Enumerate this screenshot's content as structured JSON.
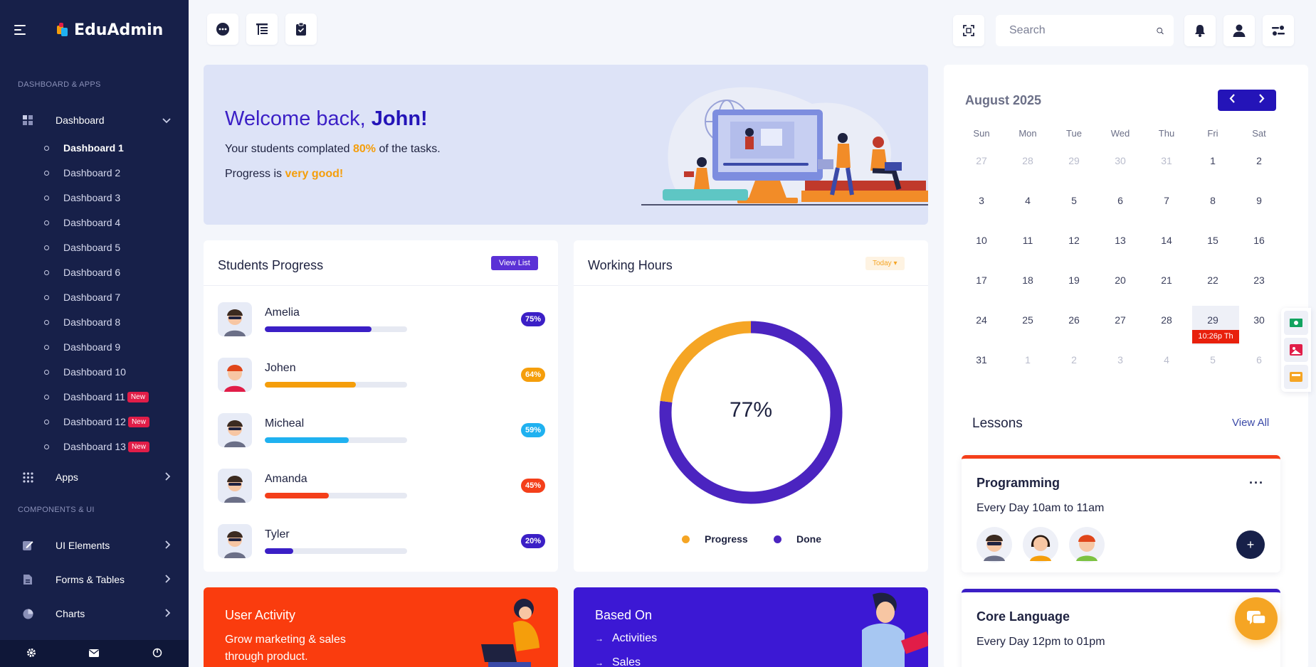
{
  "brand": {
    "name": "EduAdmin"
  },
  "sidebar": {
    "section1": "DASHBOARD & APPS",
    "dashboard_label": "Dashboard",
    "items": [
      {
        "label": "Dashboard 1"
      },
      {
        "label": "Dashboard 2"
      },
      {
        "label": "Dashboard 3"
      },
      {
        "label": "Dashboard 4"
      },
      {
        "label": "Dashboard 5"
      },
      {
        "label": "Dashboard 6"
      },
      {
        "label": "Dashboard 7"
      },
      {
        "label": "Dashboard 8"
      },
      {
        "label": "Dashboard 9"
      },
      {
        "label": "Dashboard 10"
      },
      {
        "label": "Dashboard 11",
        "badge": "New"
      },
      {
        "label": "Dashboard 12",
        "badge": "New"
      },
      {
        "label": "Dashboard 13",
        "badge": "New"
      }
    ],
    "apps_label": "Apps",
    "section2": "COMPONENTS & UI",
    "ui_elements_label": "UI Elements",
    "forms_label": "Forms & Tables",
    "charts_label": "Charts"
  },
  "topbar": {
    "search_placeholder": "Search"
  },
  "welcome": {
    "greeting": "Welcome back, ",
    "name": "John!",
    "line1_pre": "Your students complated ",
    "line1_value": "80%",
    "line1_post": " of the tasks.",
    "line2_pre": "Progress is ",
    "line2_value": "very good!"
  },
  "students_progress": {
    "title": "Students Progress",
    "button": "View List",
    "students": [
      {
        "name": "Amelia",
        "percent_label": "75%",
        "progress": 75,
        "color": "#3b1fc6"
      },
      {
        "name": "Johen",
        "percent_label": "64%",
        "progress": 64,
        "color": "#f59e0b"
      },
      {
        "name": "Micheal",
        "percent_label": "59%",
        "progress": 59,
        "color": "#1fb1f0"
      },
      {
        "name": "Amanda",
        "percent_label": "45%",
        "progress": 45,
        "color": "#f43f1a"
      },
      {
        "name": "Tyler",
        "percent_label": "20%",
        "progress": 20,
        "color": "#3b1fc6"
      }
    ]
  },
  "working_hours": {
    "title": "Working Hours",
    "dropdown": "Today",
    "center_label": "77%",
    "legend_progress": "Progress",
    "legend_done": "Done",
    "colors": {
      "progress": "#f5a524",
      "done": "#4b24c0"
    }
  },
  "chart_data": {
    "type": "pie",
    "categories": [
      "Progress",
      "Done"
    ],
    "values": [
      23,
      77
    ],
    "title": "Working Hours"
  },
  "user_activity": {
    "title": "User Activity",
    "subtitle": "Grow marketing & sales through product."
  },
  "based_on": {
    "title": "Based On",
    "items": [
      "Activities",
      "Sales"
    ]
  },
  "calendar": {
    "month": "August 2025",
    "weekdays": [
      "Sun",
      "Mon",
      "Tue",
      "Wed",
      "Thu",
      "Fri",
      "Sat"
    ],
    "weeks": [
      [
        "27",
        "28",
        "29",
        "30",
        "31",
        "1",
        "2"
      ],
      [
        "3",
        "4",
        "5",
        "6",
        "7",
        "8",
        "9"
      ],
      [
        "10",
        "11",
        "12",
        "13",
        "14",
        "15",
        "16"
      ],
      [
        "17",
        "18",
        "19",
        "20",
        "21",
        "22",
        "23"
      ],
      [
        "24",
        "25",
        "26",
        "27",
        "28",
        "29",
        "30"
      ],
      [
        "31",
        "1",
        "2",
        "3",
        "4",
        "5",
        "6"
      ]
    ],
    "today_note": "10:26p Th"
  },
  "lessons": {
    "title": "Lessons",
    "view_all": "View All",
    "items": [
      {
        "title": "Programming",
        "time": "Every Day 10am to 11am",
        "color": "#f43f1a"
      },
      {
        "title": "Core Language",
        "time": "Every Day 12pm to 01pm",
        "color": "#3b1fc6"
      }
    ]
  }
}
